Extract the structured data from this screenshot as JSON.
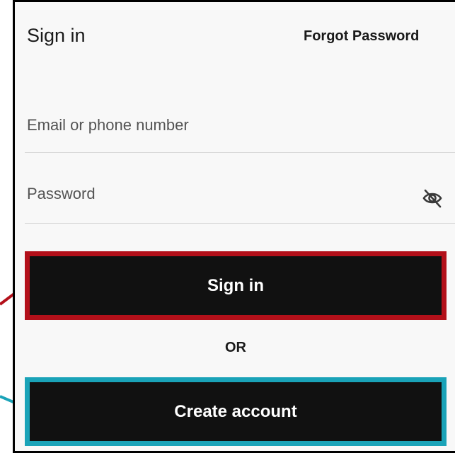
{
  "header": {
    "title": "Sign in",
    "forgot_password": "Forgot Password"
  },
  "form": {
    "email_placeholder": "Email or phone number",
    "email_value": "",
    "password_placeholder": "Password",
    "password_value": "",
    "password_toggle_icon": "eye-slash-icon"
  },
  "actions": {
    "sign_in_label": "Sign in",
    "or_label": "OR",
    "create_account_label": "Create account"
  },
  "colors": {
    "sign_in_highlight": "#b3101a",
    "create_account_highlight": "#1aa3b8",
    "button_background": "#111111"
  }
}
